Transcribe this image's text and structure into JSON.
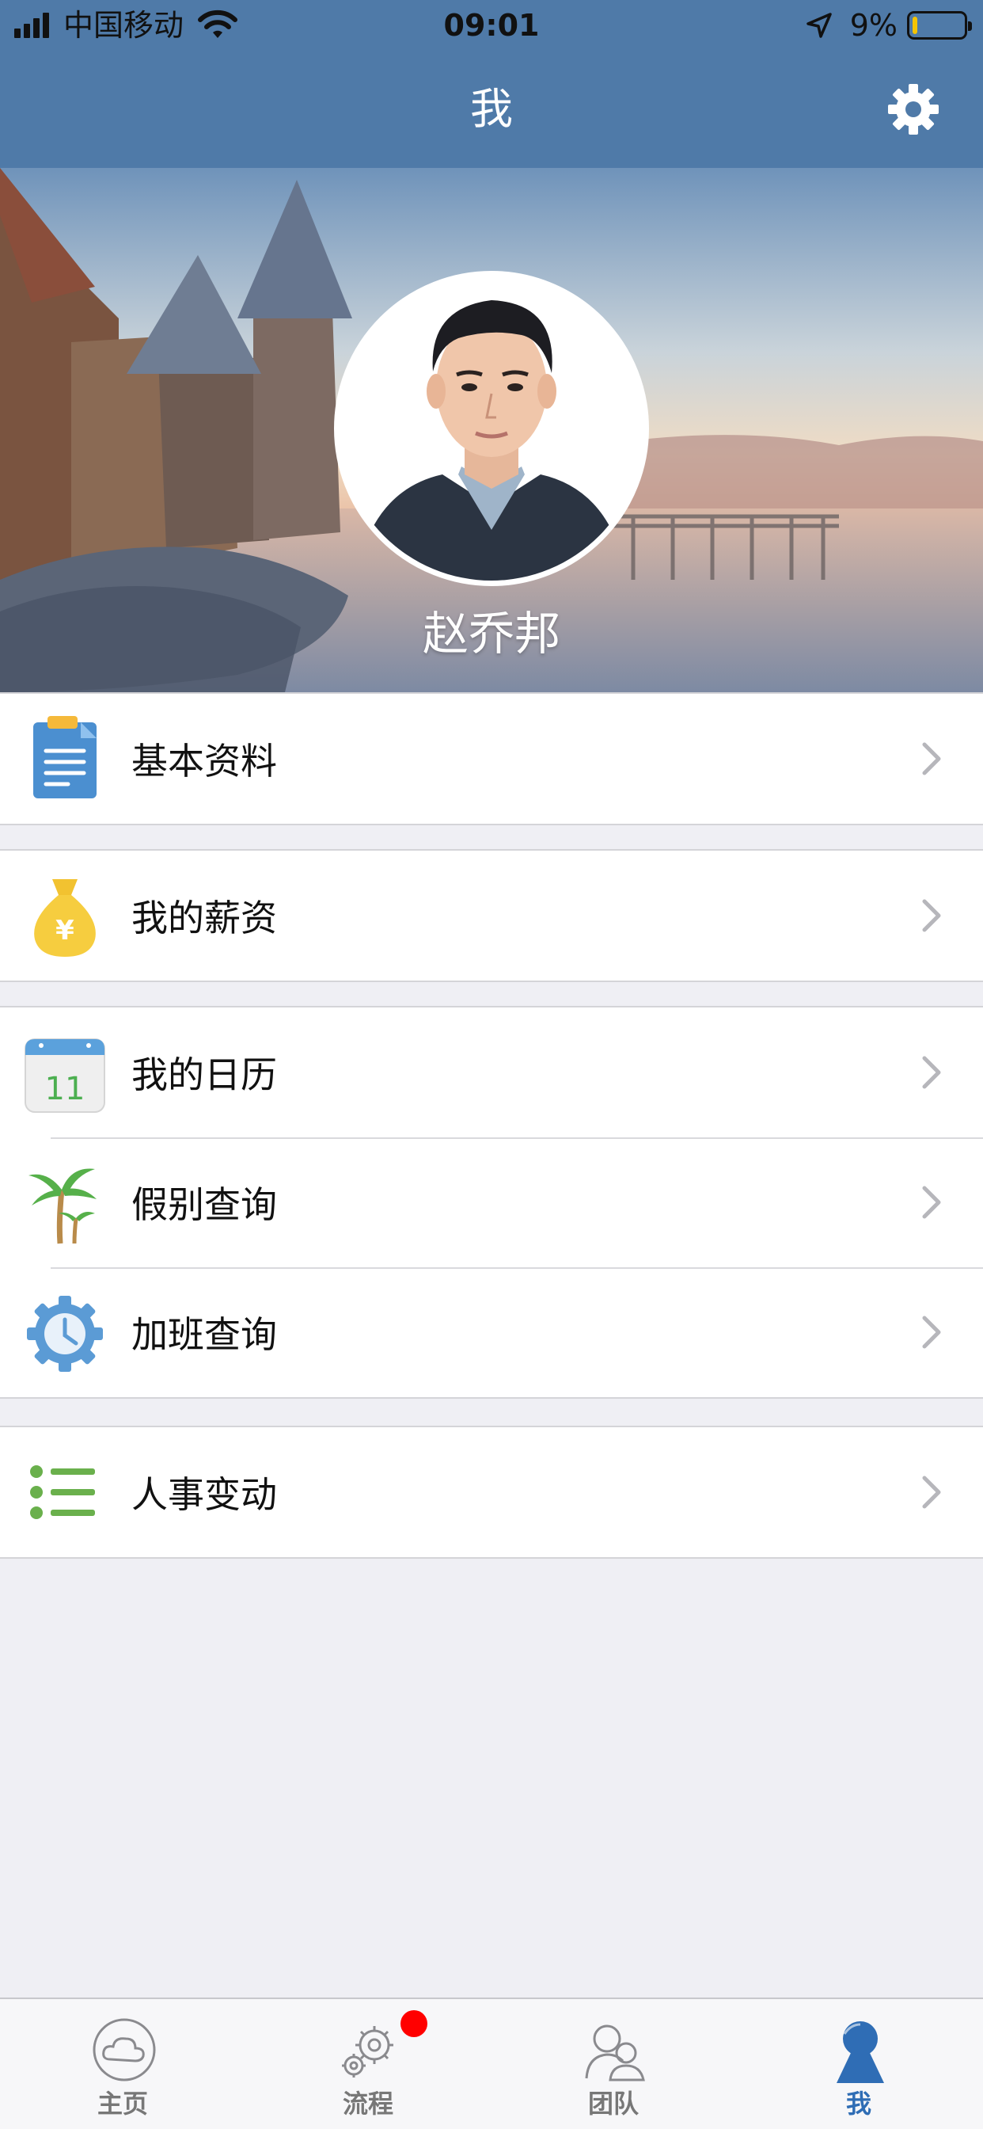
{
  "status_bar": {
    "carrier": "中国移动",
    "time": "09:01",
    "battery_percent_text": "9%",
    "battery_level": 0.09
  },
  "nav": {
    "title": "我"
  },
  "profile": {
    "name": "赵乔邦"
  },
  "menu_groups": [
    {
      "items": [
        {
          "label": "基本资料",
          "icon": "document-icon"
        }
      ]
    },
    {
      "items": [
        {
          "label": "我的薪资",
          "icon": "money-bag-icon"
        }
      ]
    },
    {
      "items": [
        {
          "label": "我的日历",
          "icon": "calendar-icon",
          "icon_text": "11"
        },
        {
          "label": "假别查询",
          "icon": "palm-tree-icon"
        },
        {
          "label": "加班查询",
          "icon": "clock-gear-icon"
        }
      ]
    },
    {
      "items": [
        {
          "label": "人事变动",
          "icon": "list-icon"
        }
      ]
    }
  ],
  "tabbar": {
    "tabs": [
      {
        "label": "主页",
        "icon": "cloud-icon",
        "active": false
      },
      {
        "label": "流程",
        "icon": "gears-icon",
        "active": false,
        "badge": true
      },
      {
        "label": "团队",
        "icon": "team-icon",
        "active": false
      },
      {
        "label": "我",
        "icon": "person-icon",
        "active": true
      }
    ]
  },
  "colors": {
    "nav_bg": "#4f7aa8",
    "page_bg": "#efeff4",
    "tab_active": "#2f6db5",
    "badge": "#ff0000"
  }
}
